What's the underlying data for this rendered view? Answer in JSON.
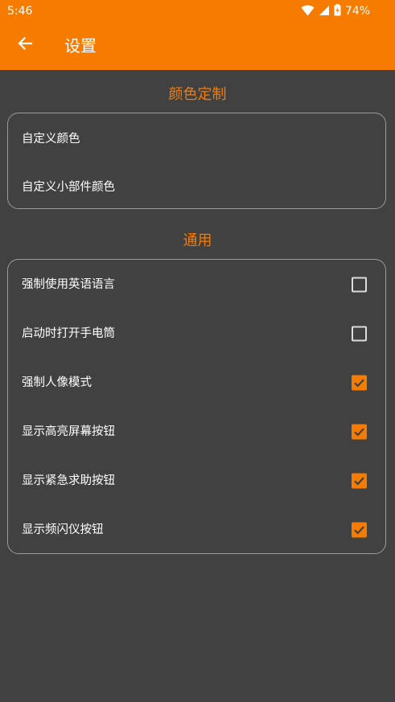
{
  "status_bar": {
    "time": "5:46",
    "battery": "74%",
    "icons": [
      "wifi-icon",
      "signal-icon",
      "battery-charging-icon"
    ]
  },
  "app_bar": {
    "title": "设置",
    "back_icon": "arrow-back-icon",
    "background_color": "#f57c00"
  },
  "colors": {
    "accent": "#f57c00",
    "background": "#414141",
    "card_border": "#9b9b9b",
    "text": "#ffffff"
  },
  "sections": {
    "color_custom": {
      "title": "颜色定制",
      "items": [
        {
          "label": "自定义颜色"
        },
        {
          "label": "自定义小部件颜色"
        }
      ]
    },
    "general": {
      "title": "通用",
      "items": [
        {
          "label": "强制使用英语语言",
          "checked": false
        },
        {
          "label": "启动时打开手电筒",
          "checked": false
        },
        {
          "label": "强制人像模式",
          "checked": true
        },
        {
          "label": "显示高亮屏幕按钮",
          "checked": true
        },
        {
          "label": "显示紧急求助按钮",
          "checked": true
        },
        {
          "label": "显示频闪仪按钮",
          "checked": true
        }
      ]
    }
  }
}
